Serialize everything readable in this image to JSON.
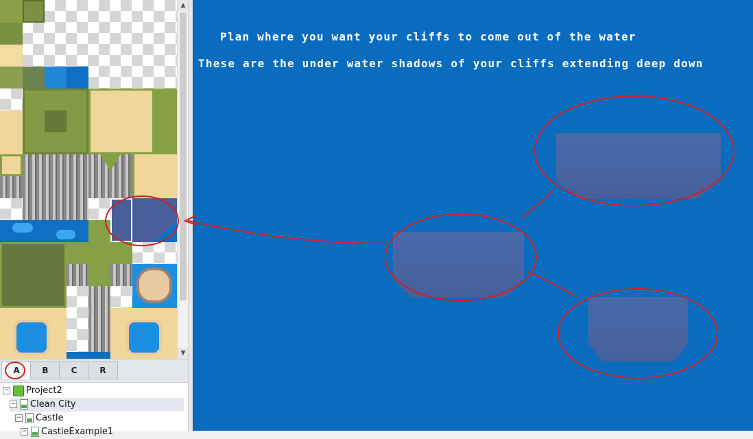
{
  "tabs": {
    "a": "A",
    "b": "B",
    "c": "C",
    "r": "R"
  },
  "tree": {
    "project": "Project2",
    "clean_city": "Clean City",
    "castle": "Castle",
    "castle_example": "CastleExample1"
  },
  "annotations": {
    "line1": "Plan where you want your cliffs to come out of the water",
    "line2": "These are the under water shadows of your cliffs extending deep down"
  },
  "colors": {
    "water": "#0a6cbf",
    "shadow": "#4a5f9a",
    "annotation_red": "#d11f1f"
  }
}
